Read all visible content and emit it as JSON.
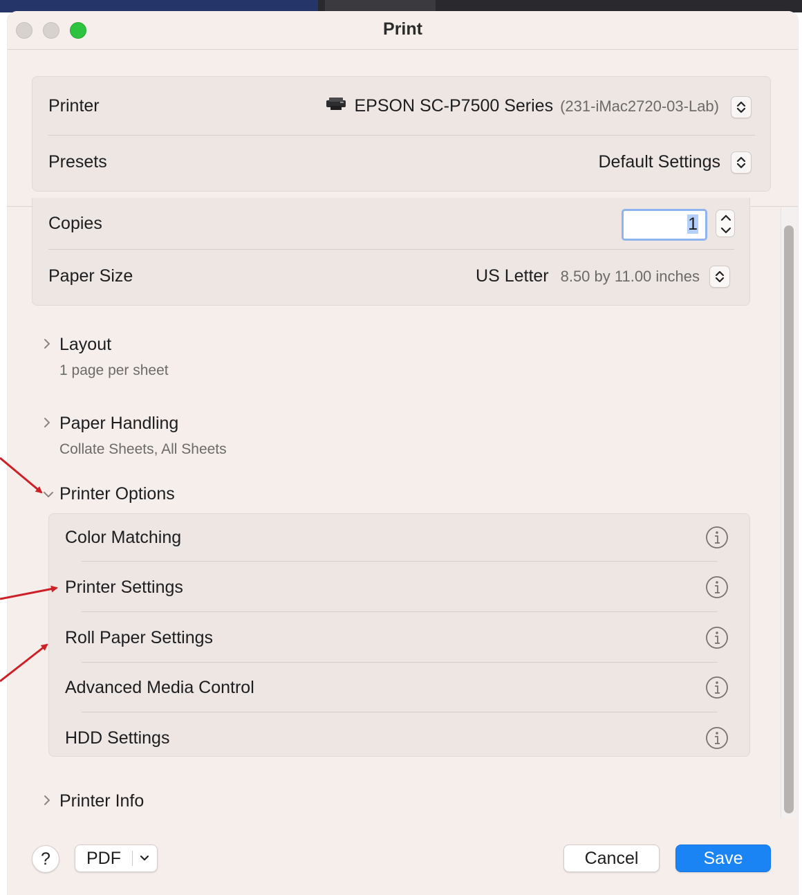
{
  "window": {
    "title": "Print"
  },
  "printer": {
    "label": "Printer",
    "name": "EPSON SC-P7500 Series",
    "host": "(231-iMac2720-03-Lab)",
    "icon": "printer-icon"
  },
  "presets": {
    "label": "Presets",
    "value": "Default Settings"
  },
  "copies": {
    "label": "Copies",
    "value": "1"
  },
  "paper_size": {
    "label": "Paper Size",
    "value": "US Letter",
    "detail": "8.50 by 11.00 inches"
  },
  "sections": [
    {
      "title": "Layout",
      "summary": "1 page per sheet",
      "expanded": false
    },
    {
      "title": "Paper Handling",
      "summary": "Collate Sheets, All Sheets",
      "expanded": false
    },
    {
      "title": "Printer Options",
      "expanded": true
    },
    {
      "title": "Printer Info",
      "expanded": false
    }
  ],
  "printer_options": [
    {
      "label": "Color Matching"
    },
    {
      "label": "Printer Settings"
    },
    {
      "label": "Roll Paper Settings"
    },
    {
      "label": "Advanced Media Control"
    },
    {
      "label": "HDD Settings"
    }
  ],
  "footer": {
    "help": "?",
    "pdf": "PDF",
    "cancel": "Cancel",
    "save": "Save"
  },
  "colors": {
    "accent": "#1a84f5",
    "window_bg": "#f6eeeb",
    "annotation_arrow": "#cc1f26"
  }
}
